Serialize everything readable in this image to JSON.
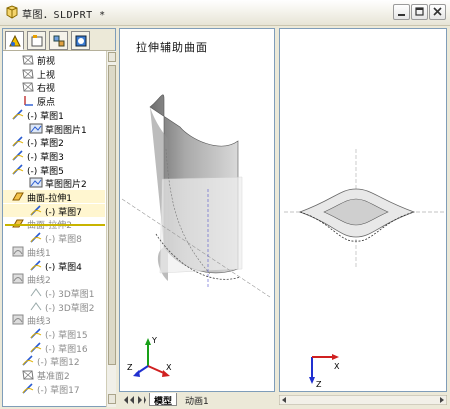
{
  "window": {
    "title": "草图．SLDPRT  *"
  },
  "tree": {
    "items": [
      {
        "label": "前视",
        "icon": "plane-icon",
        "dim": false
      },
      {
        "label": "上视",
        "icon": "plane-icon",
        "dim": false
      },
      {
        "label": "右视",
        "icon": "plane-icon",
        "dim": false
      },
      {
        "label": "原点",
        "icon": "origin-icon",
        "dim": false
      },
      {
        "label": "(-) 草图1",
        "icon": "sketch-icon",
        "dim": false
      },
      {
        "label": "草图图片1",
        "icon": "sketch-picture-icon",
        "dim": false
      },
      {
        "label": "(-) 草图2",
        "icon": "sketch-icon",
        "dim": false
      },
      {
        "label": "(-) 草图3",
        "icon": "sketch-icon",
        "dim": false
      },
      {
        "label": "(-) 草图5",
        "icon": "sketch-icon",
        "dim": false
      },
      {
        "label": "草图图片2",
        "icon": "sketch-picture-icon",
        "dim": false
      },
      {
        "label": "曲面-拉伸1",
        "icon": "surface-extrude-icon",
        "dim": false
      },
      {
        "label": "(-) 草图7",
        "icon": "sketch-icon",
        "dim": false
      },
      {
        "label": "曲面-拉伸2",
        "icon": "surface-extrude-icon",
        "dim": true
      },
      {
        "label": "(-) 草图8",
        "icon": "sketch-icon",
        "dim": true
      },
      {
        "label": "曲线1",
        "icon": "curve-icon",
        "dim": true
      },
      {
        "label": "(-) 草图4",
        "icon": "sketch-icon",
        "dim": false
      },
      {
        "label": "曲线2",
        "icon": "curve-icon",
        "dim": true
      },
      {
        "label": "(-) 3D草图1",
        "icon": "3d-sketch-icon",
        "dim": true
      },
      {
        "label": "(-) 3D草图2",
        "icon": "3d-sketch-icon",
        "dim": true
      },
      {
        "label": "曲线3",
        "icon": "curve-icon",
        "dim": true
      },
      {
        "label": "(-) 草图15",
        "icon": "sketch-icon",
        "dim": true
      },
      {
        "label": "(-) 草图16",
        "icon": "sketch-icon",
        "dim": true
      },
      {
        "label": "(-) 草图12",
        "icon": "sketch-icon",
        "dim": true
      },
      {
        "label": "基准面2",
        "icon": "plane-icon",
        "dim": true
      },
      {
        "label": "(-) 草图17",
        "icon": "sketch-icon",
        "dim": true
      }
    ]
  },
  "viewport": {
    "left_label": "拉伸辅助曲面"
  },
  "bottom_tabs": {
    "active": "模型",
    "other": "动画1"
  },
  "axes": {
    "x": "X",
    "y": "Y",
    "z": "Z"
  }
}
